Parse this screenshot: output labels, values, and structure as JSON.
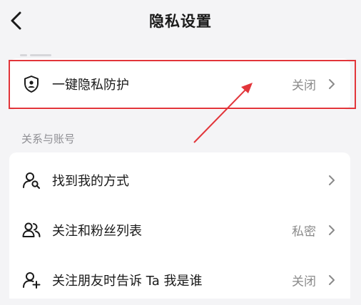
{
  "header": {
    "title": "隐私设置"
  },
  "one_key": {
    "label": "一键隐私防护",
    "value": "关闭"
  },
  "section": {
    "label": "关系与账号"
  },
  "rows": [
    {
      "label": "找到我的方式",
      "value": ""
    },
    {
      "label": "关注和粉丝列表",
      "value": "私密"
    },
    {
      "label": "关注朋友时告诉 Ta 我是谁",
      "value": "关闭"
    }
  ],
  "colors": {
    "highlight": "#e2353a",
    "background": "#f4f4f6",
    "card": "#ffffff",
    "muted": "#8a8a8a"
  }
}
